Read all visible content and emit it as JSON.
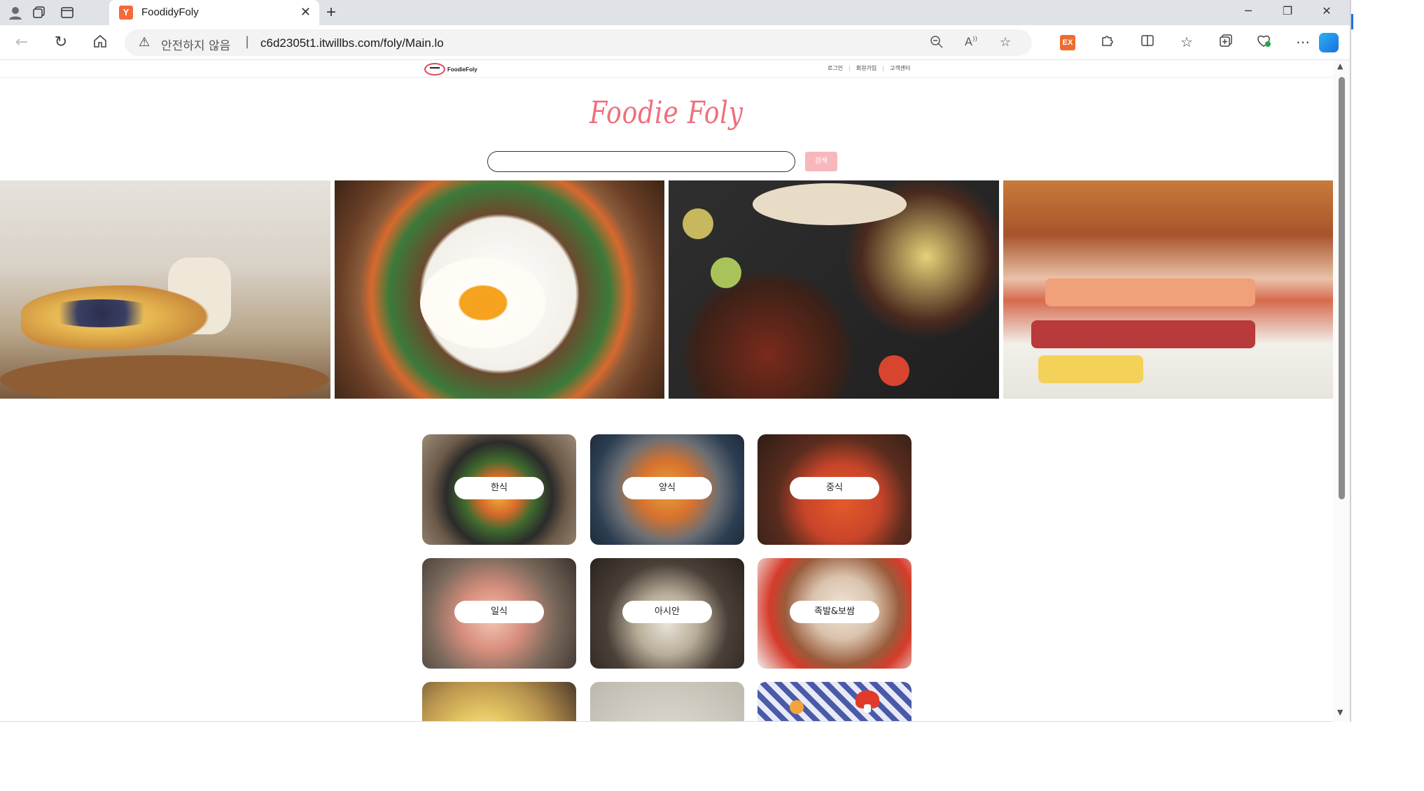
{
  "browser": {
    "tab_title": "FoodidyFoly",
    "tab_favicon": "Y",
    "new_tab_label": "+",
    "security_label": "안전하지 않음",
    "url": "c6d2305t1.itwillbs.com/foly/Main.lo",
    "extension_badge": "EX"
  },
  "site": {
    "logo_text": "FoodieFoly",
    "top_links": [
      "로그인",
      "회원가입",
      "고객센터"
    ],
    "brand_title": "Foodie Foly",
    "search": {
      "placeholder": "",
      "button_label": "검색"
    }
  },
  "categories": [
    {
      "label": "한식"
    },
    {
      "label": "양식"
    },
    {
      "label": "중식"
    },
    {
      "label": "일식"
    },
    {
      "label": "아시안"
    },
    {
      "label": "족발&보쌈"
    }
  ],
  "colors": {
    "brand": "#ef6f7d",
    "search_button": "#f7b8bd",
    "tab_favicon": "#f26b3a"
  },
  "icons": {
    "profile": "profile-icon",
    "workspaces": "workspaces-icon",
    "tab_actions": "tab-actions-icon",
    "back": "back-arrow-icon",
    "refresh": "refresh-icon",
    "home": "home-icon",
    "warning": "warning-icon",
    "zoom": "zoom-icon",
    "read_aloud": "read-aloud-icon",
    "favorite": "star-icon",
    "extensions": "puzzle-icon",
    "split": "split-screen-icon",
    "favorites_list": "favorites-list-icon",
    "collections": "collections-icon",
    "health": "browser-essentials-icon",
    "more": "more-icon",
    "copilot": "copilot-icon"
  }
}
